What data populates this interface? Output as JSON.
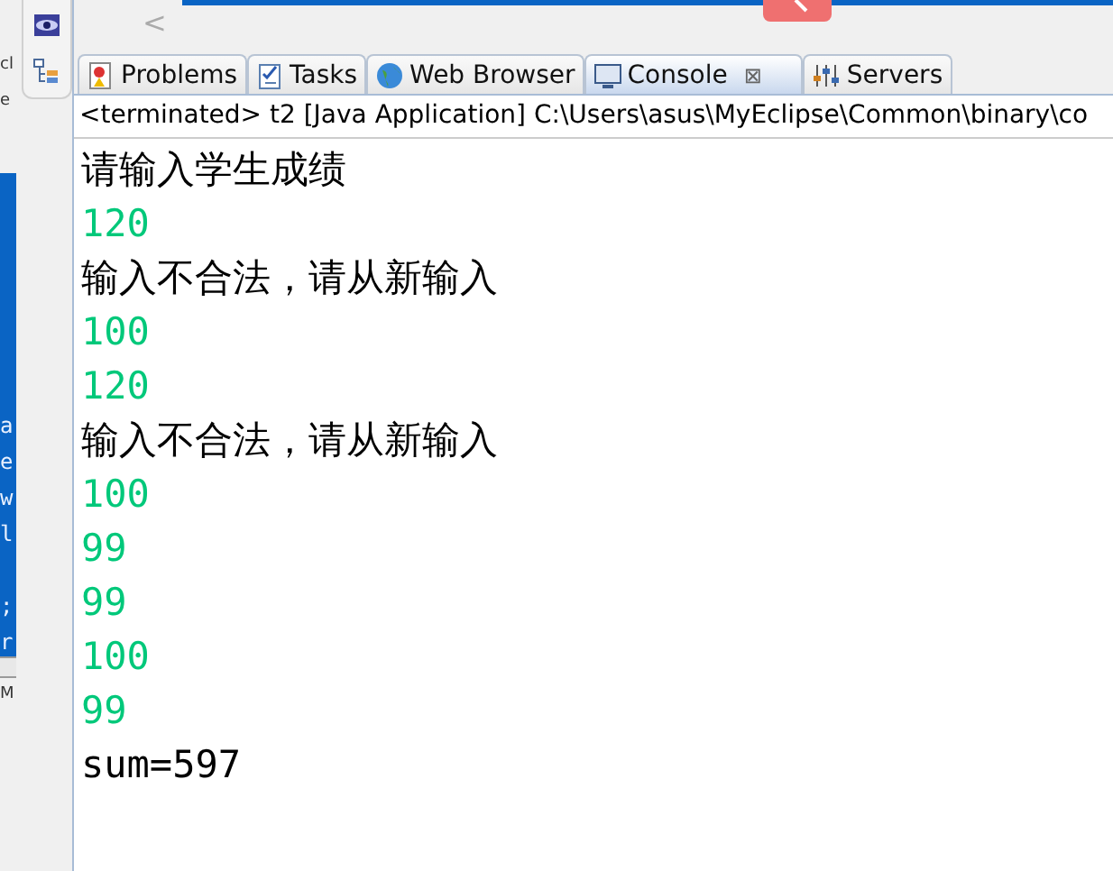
{
  "side_fragments": [
    "cl",
    "e"
  ],
  "editor_fragments": [
    "a",
    "e",
    "w",
    "l",
    ";",
    "r"
  ],
  "lower_fragment": "M",
  "scroll_arrow": "<",
  "tabs": [
    {
      "label": "Problems",
      "selected": false,
      "closable": false
    },
    {
      "label": "Tasks",
      "selected": false,
      "closable": false
    },
    {
      "label": "Web Browser",
      "selected": false,
      "closable": false
    },
    {
      "label": "Console",
      "selected": true,
      "closable": true
    },
    {
      "label": "Servers",
      "selected": false,
      "closable": false
    }
  ],
  "close_glyph": "⊠",
  "console_header": "<terminated> t2 [Java Application] C:\\Users\\asus\\MyEclipse\\Common\\binary\\co",
  "output": [
    {
      "text": "请输入学生成绩",
      "kind": "out"
    },
    {
      "text": "120",
      "kind": "in"
    },
    {
      "text": "输入不合法，请从新输入",
      "kind": "out"
    },
    {
      "text": "100",
      "kind": "in"
    },
    {
      "text": "120",
      "kind": "in"
    },
    {
      "text": "输入不合法，请从新输入",
      "kind": "out"
    },
    {
      "text": "100",
      "kind": "in"
    },
    {
      "text": "99",
      "kind": "in"
    },
    {
      "text": "99",
      "kind": "in"
    },
    {
      "text": "100",
      "kind": "in"
    },
    {
      "text": "99",
      "kind": "in"
    },
    {
      "text": "sum=597",
      "kind": "out"
    }
  ]
}
